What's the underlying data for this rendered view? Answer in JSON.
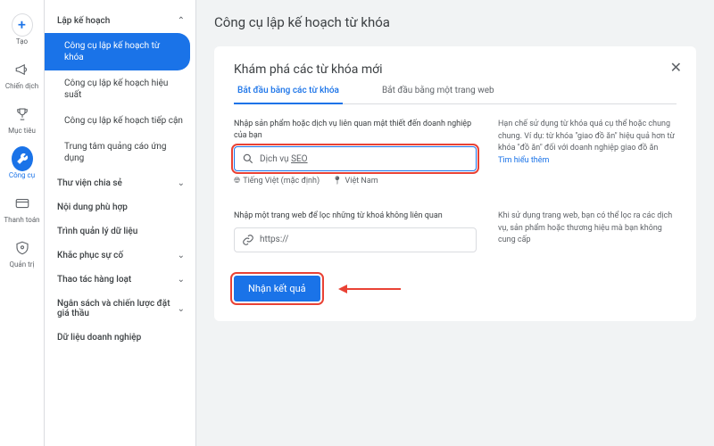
{
  "rail": {
    "create": "Tạo",
    "campaigns": "Chiến dịch",
    "goals": "Mục tiêu",
    "tools": "Công cụ",
    "billing": "Thanh toán",
    "admin": "Quản trị"
  },
  "sidebar": {
    "planning": "Lập kế hoạch",
    "items": {
      "keyword_planner": "Công cụ lập kế hoạch từ khóa",
      "performance_planner": "Công cụ lập kế hoạch hiệu suất",
      "reach_planner": "Công cụ lập kế hoạch tiếp cận",
      "app_ads_hub": "Trung tâm quảng cáo ứng dụng"
    },
    "shared_library": "Thư viện chia sẻ",
    "content_suitability": "Nội dung phù hợp",
    "data_manager": "Trình quản lý dữ liệu",
    "troubleshooting": "Khắc phục sự cố",
    "bulk_actions": "Thao tác hàng loạt",
    "budgets": "Ngân sách và chiến lược đặt giá thầu",
    "business_data": "Dữ liệu doanh nghiệp"
  },
  "page": {
    "title": "Công cụ lập kế hoạch từ khóa"
  },
  "card": {
    "title": "Khám phá các từ khóa mới",
    "tab_keywords": "Bắt đầu bằng các từ khóa",
    "tab_website": "Bắt đầu bằng một trang web",
    "kw_label": "Nhập sản phẩm hoặc dịch vụ liên quan mật thiết đến doanh nghiệp của bạn",
    "kw_placeholder_prefix": "Dịch vụ ",
    "kw_placeholder_underlined": "SEO",
    "lang": "Tiếng Việt (mặc định)",
    "loc": "Việt Nam",
    "kw_help": "Hạn chế sử dụng từ khóa quá cụ thể hoặc chung chung. Ví dụ: từ khóa \"giao đồ ăn\" hiệu quả hơn từ khóa \"đồ ăn\" đối với doanh nghiệp giao đồ ăn",
    "learn_more": "Tìm hiểu thêm",
    "site_label": "Nhập một trang web để lọc những từ khoá không liên quan",
    "site_placeholder": "https://",
    "site_help": "Khi sử dụng trang web, bạn có thể lọc ra các dịch vụ, sản phẩm hoặc thương hiệu mà bạn không cung cấp",
    "submit": "Nhận kết quả"
  }
}
